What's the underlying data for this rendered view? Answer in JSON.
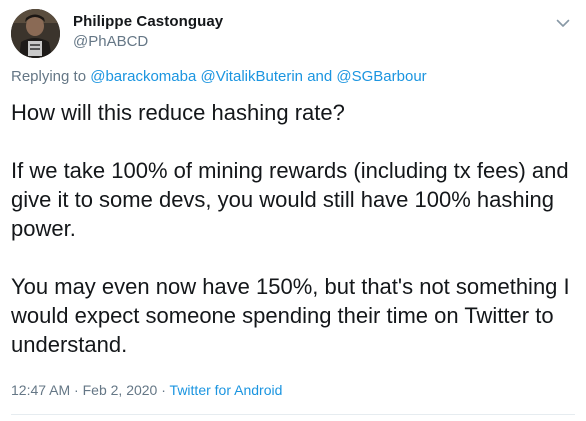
{
  "author": {
    "display_name": "Philippe Castonguay",
    "handle": "@PhABCD"
  },
  "reply_context": {
    "prefix": "Replying to",
    "mention_1": "@barackomaba",
    "mention_2": "@VitalikButerin",
    "conjunction": "and",
    "mention_3": "@SGBarbour"
  },
  "tweet": {
    "paragraphs": [
      "How will this reduce hashing rate?",
      "If we take 100% of mining rewards (including tx fees) and give it to some devs, you would still have 100% hashing power.",
      "You may even now have 150%, but that's not something I would expect someone spending their time on Twitter to understand."
    ]
  },
  "meta": {
    "time": "12:47 AM",
    "separator": "·",
    "date": "Feb 2, 2020",
    "source": "Twitter for Android"
  },
  "icons": {
    "menu": "chevron-down-icon"
  },
  "colors": {
    "link": "#1b95e0",
    "secondary_text": "#657786",
    "primary_text": "#14171a",
    "divider": "#e6ecf0"
  }
}
